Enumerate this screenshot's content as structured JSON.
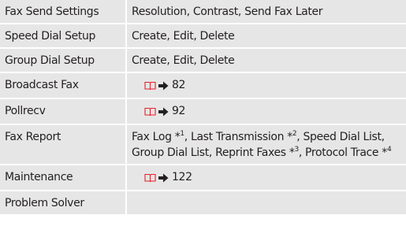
{
  "colors": {
    "cell_background": "#e6e6e6",
    "text": "#231f20",
    "book_icon": "#e8202a",
    "arrow_icon": "#231f20"
  },
  "rows": [
    {
      "name": "Fax Send Settings",
      "description": "Resolution, Contrast, Send Fax Later"
    },
    {
      "name": "Speed Dial Setup",
      "description": "Create, Edit, Delete"
    },
    {
      "name": "Group Dial Setup",
      "description": "Create, Edit, Delete"
    },
    {
      "name": "Broadcast Fax",
      "page_ref": "82",
      "icons": [
        "book-icon",
        "arrow-icon"
      ]
    },
    {
      "name": "Pollrecv",
      "page_ref": "92",
      "icons": [
        "book-icon",
        "arrow-icon"
      ]
    },
    {
      "name": "Fax Report",
      "report_items": {
        "fax_log": "Fax Log",
        "fax_log_note": "*",
        "fax_log_num": "1",
        "sep1": ", Last Transmission ",
        "last_tx_note": "*",
        "last_tx_num": "2",
        "sep2": ", Speed Dial List, Group Dial List, Reprint Faxes ",
        "reprint_note": "*",
        "reprint_num": "3",
        "sep3": ", Protocol Trace ",
        "protocol_note": "*",
        "protocol_num": "4"
      }
    },
    {
      "name": "Maintenance",
      "page_ref": "122",
      "icons": [
        "book-icon",
        "arrow-icon"
      ]
    },
    {
      "name": "Problem Solver",
      "description": ""
    }
  ]
}
